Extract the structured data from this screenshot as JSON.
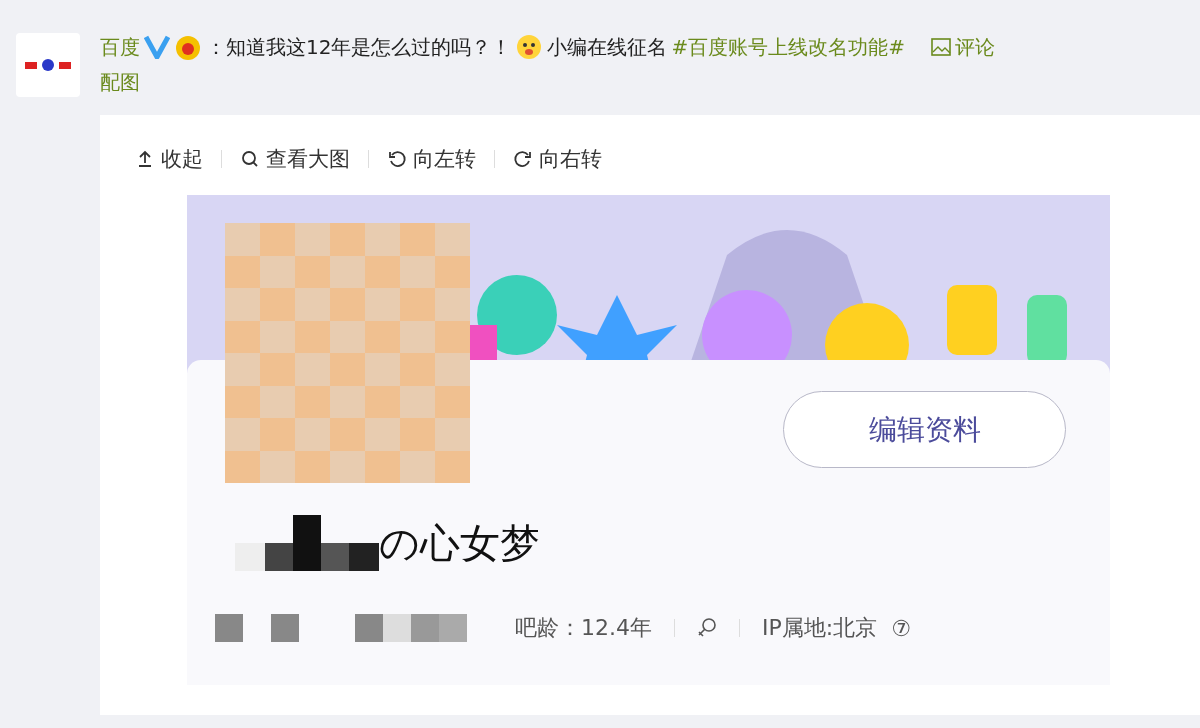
{
  "post": {
    "author": "百度",
    "verified": true,
    "separator": "：",
    "text": "知道我这12年是怎么过的吗？！",
    "text2": "小编在线征名",
    "hashtag": "#百度账号上线改名功能#",
    "image_label": [
      "评论",
      "配图"
    ]
  },
  "toolbar": [
    "收起",
    "查看大图",
    "向左转",
    "向右转"
  ],
  "profile": {
    "edit_button": "编辑资料",
    "name_suffix": "の心女梦",
    "age": "吧龄：12.4年",
    "ip": "IP属地:北京",
    "info_icon": "⑦"
  }
}
